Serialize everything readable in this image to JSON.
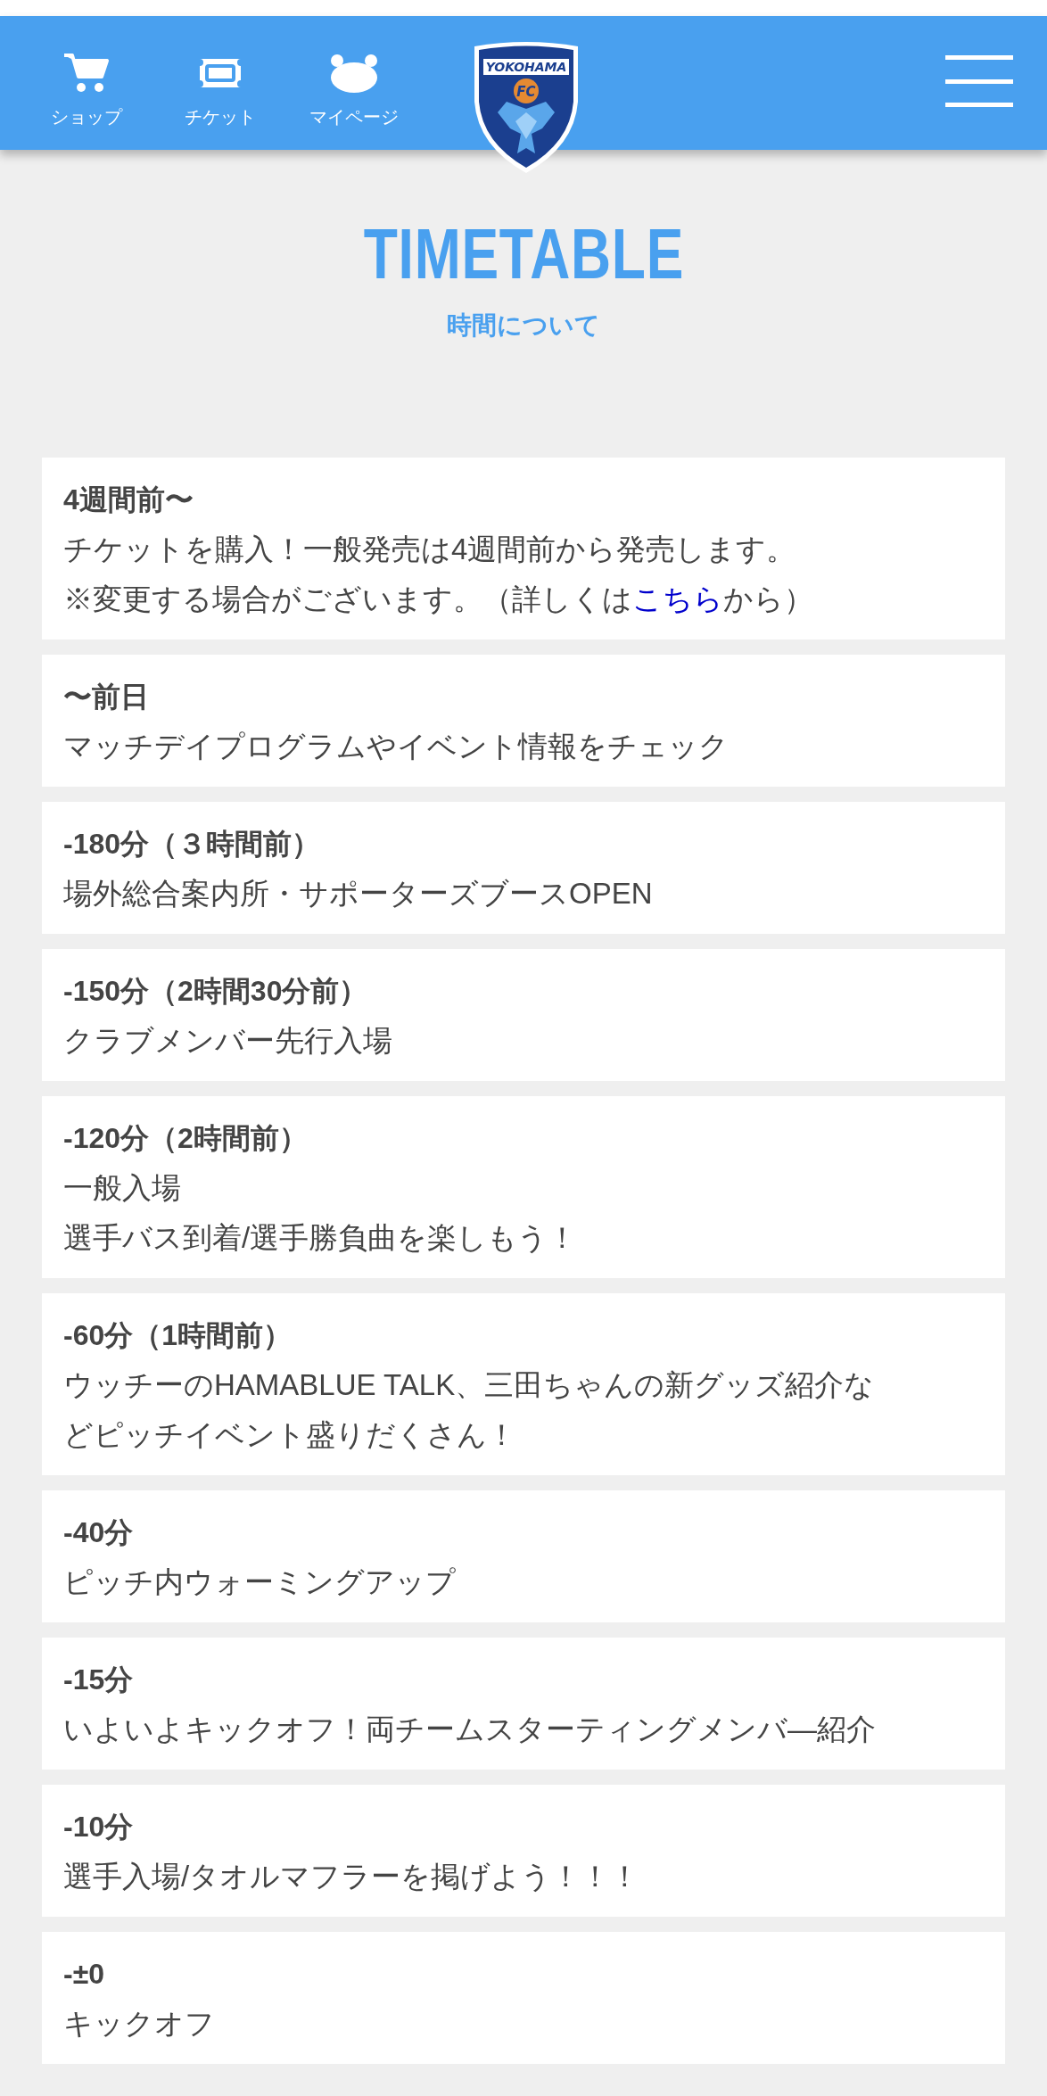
{
  "header": {
    "nav": [
      {
        "kind": "cart",
        "label": "ショップ"
      },
      {
        "kind": "ticket",
        "label": "チケット"
      },
      {
        "kind": "face",
        "label": "マイページ"
      }
    ],
    "logo": {
      "wordmark": "YOKOHAMA",
      "badge": "FC"
    }
  },
  "title": "TIMETABLE",
  "subtitle": "時間について",
  "entries": [
    {
      "time": "4週間前〜",
      "lines": [
        [
          {
            "kind": "text",
            "text": "チケットを購入！一般発売は4週間前から発売します。"
          }
        ],
        [
          {
            "kind": "text",
            "text": "※変更する場合がございます。（詳しくは"
          },
          {
            "kind": "link",
            "text": "こちら"
          },
          {
            "kind": "text",
            "text": "から）"
          }
        ]
      ]
    },
    {
      "time": "〜前日",
      "lines": [
        [
          {
            "kind": "text",
            "text": "マッチデイプログラムやイベント情報をチェック"
          }
        ]
      ]
    },
    {
      "time": "-180分（３時間前）",
      "lines": [
        [
          {
            "kind": "text",
            "text": "場外総合案内所・サポーターズブースOPEN"
          }
        ]
      ]
    },
    {
      "time": "-150分（2時間30分前）",
      "lines": [
        [
          {
            "kind": "text",
            "text": "クラブメンバー先行入場"
          }
        ]
      ]
    },
    {
      "time": "-120分（2時間前）",
      "lines": [
        [
          {
            "kind": "text",
            "text": "一般入場"
          }
        ],
        [
          {
            "kind": "text",
            "text": "選手バス到着/選手勝負曲を楽しもう！"
          }
        ]
      ]
    },
    {
      "time": "-60分（1時間前）",
      "lines": [
        [
          {
            "kind": "text",
            "text": "ウッチーのHAMABLUE TALK、三田ちゃんの新グッズ紹介などピッチイベント盛りだくさん！"
          }
        ]
      ]
    },
    {
      "time": "-40分",
      "lines": [
        [
          {
            "kind": "text",
            "text": "ピッチ内ウォーミングアップ"
          }
        ]
      ]
    },
    {
      "time": "-15分",
      "lines": [
        [
          {
            "kind": "text",
            "text": "いよいよキックオフ！両チームスターティングメンバ―紹介"
          }
        ]
      ]
    },
    {
      "time": "-10分",
      "lines": [
        [
          {
            "kind": "text",
            "text": "選手入場/タオルマフラーを掲げよう！！！"
          }
        ]
      ]
    },
    {
      "time": "-±0",
      "lines": [
        [
          {
            "kind": "text",
            "text": "キックオフ"
          }
        ]
      ]
    }
  ]
}
